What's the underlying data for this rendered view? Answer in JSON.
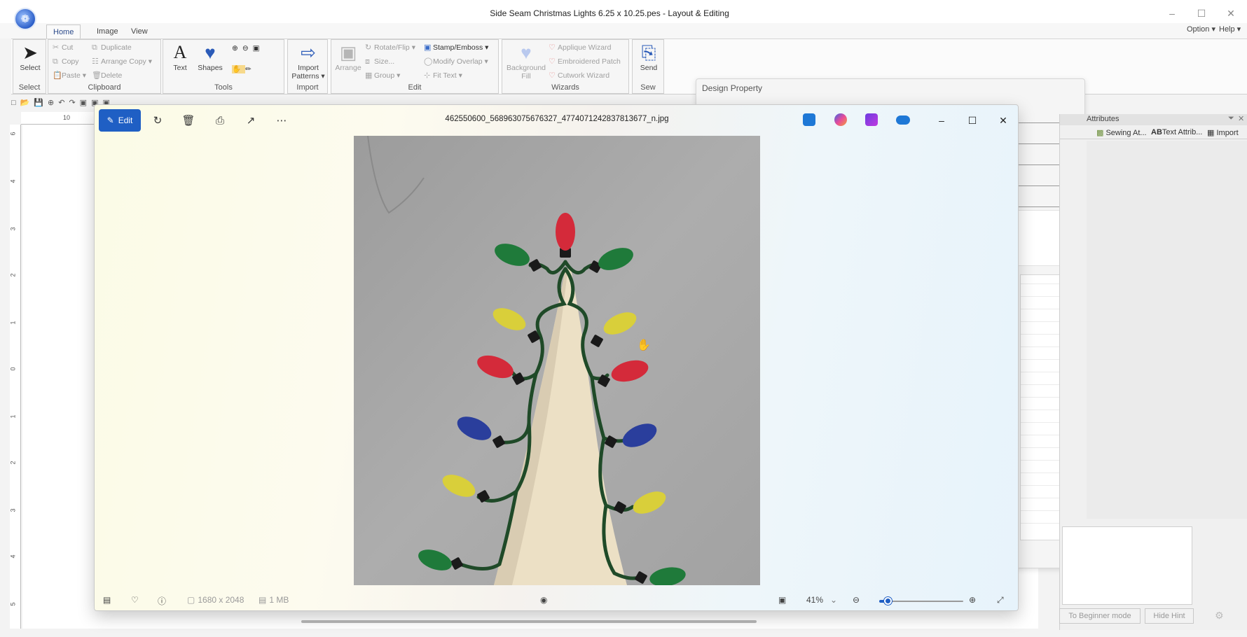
{
  "app": {
    "title": "Side Seam Christmas Lights 6.25 x 10.25.pes - Layout & Editing",
    "tabs": [
      "Home",
      "Image",
      "View"
    ],
    "active_tab": "Home",
    "right_menu": {
      "option": "Option",
      "help": "Help"
    },
    "ribbon": {
      "select": {
        "label": "Select",
        "group": "Select"
      },
      "clipboard": {
        "cut": "Cut",
        "copy": "Copy",
        "paste": "Paste",
        "duplicate": "Duplicate",
        "arrange_copy": "Arrange Copy",
        "delete": "Delete",
        "group": "Clipboard"
      },
      "tools": {
        "text": "Text",
        "shapes": "Shapes",
        "group": "Tools"
      },
      "import": {
        "label1": "Import",
        "label2": "Patterns",
        "group": "Import"
      },
      "edit": {
        "arrange": "Arrange",
        "rotate_flip": "Rotate/Flip",
        "size": "Size...",
        "group_btn": "Group",
        "stamp_emboss": "Stamp/Emboss",
        "modify_overlap": "Modify Overlap",
        "fit_text": "Fit Text",
        "group": "Edit"
      },
      "wizards": {
        "background_fill1": "Background",
        "background_fill2": "Fill",
        "applique": "Applique Wizard",
        "embroidered_patch": "Embroidered Patch",
        "cutwork": "Cutwork Wizard",
        "group": "Wizards"
      },
      "sew": {
        "send": "Send",
        "group": "Sew"
      }
    },
    "ruler": {
      "top_tick": "10",
      "left_ticks": [
        "6",
        "4",
        "3",
        "2",
        "1",
        "0",
        "1",
        "2",
        "3",
        "4",
        "5"
      ]
    },
    "design_property": {
      "title": "Design Property"
    },
    "attributes": {
      "title": "Attributes",
      "tabs": [
        "Sewing At...",
        "Text Attrib...",
        "Import"
      ],
      "buttons": {
        "beginner": "To Beginner mode",
        "hide_hint": "Hide Hint"
      }
    }
  },
  "photos": {
    "toolbar": {
      "edit_label": "Edit"
    },
    "filename": "462550600_568963075676327_4774071242837813677_n.jpg",
    "icons": [
      "rotate-icon",
      "delete-icon",
      "print-icon",
      "share-icon",
      "more-icon"
    ],
    "bottom": {
      "dimensions": "1680 x 2048",
      "size": "1 MB",
      "zoom": "41%"
    },
    "zoom_fraction": 0.1,
    "colors": {
      "accent": "#1f5fc4"
    }
  }
}
